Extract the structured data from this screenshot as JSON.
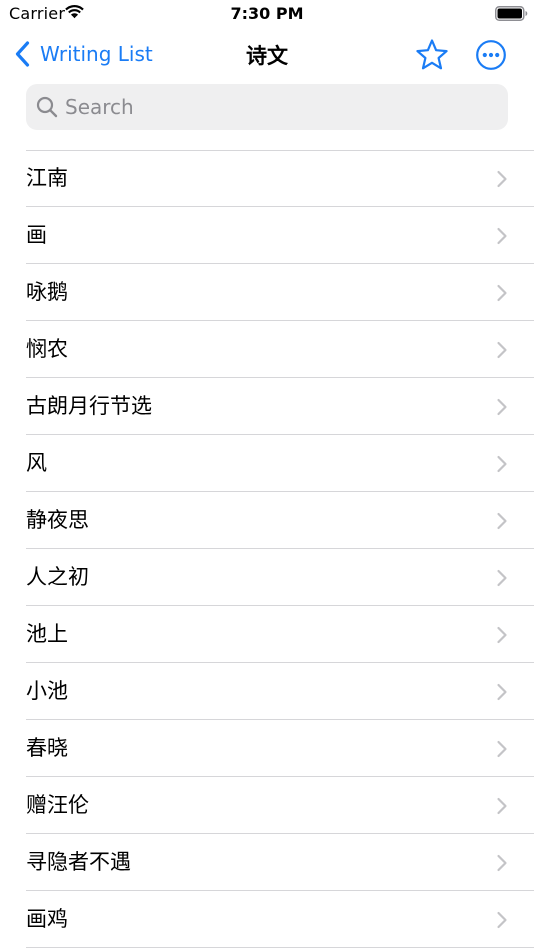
{
  "status_bar": {
    "carrier": "Carrier",
    "time": "7:30 PM"
  },
  "nav": {
    "back_label": "Writing List",
    "title": "诗文",
    "icons": {
      "back": "chevron-left-icon",
      "favorite": "star-icon",
      "more": "ellipsis-circle-icon"
    }
  },
  "search": {
    "placeholder": "Search",
    "value": ""
  },
  "list": {
    "items": [
      {
        "label": "江南"
      },
      {
        "label": "画"
      },
      {
        "label": "咏鹅"
      },
      {
        "label": "悯农"
      },
      {
        "label": "古朗月行节选"
      },
      {
        "label": "风"
      },
      {
        "label": "静夜思"
      },
      {
        "label": "人之初"
      },
      {
        "label": "池上"
      },
      {
        "label": "小池"
      },
      {
        "label": "春晓"
      },
      {
        "label": "赠汪伦"
      },
      {
        "label": "寻隐者不遇"
      },
      {
        "label": "画鸡"
      }
    ]
  },
  "colors": {
    "accent": "#1a7cf5",
    "separator": "#d6d6d9",
    "search_bg": "#efeff0",
    "chevron": "#c4c4c7",
    "placeholder": "#8b8b90"
  }
}
